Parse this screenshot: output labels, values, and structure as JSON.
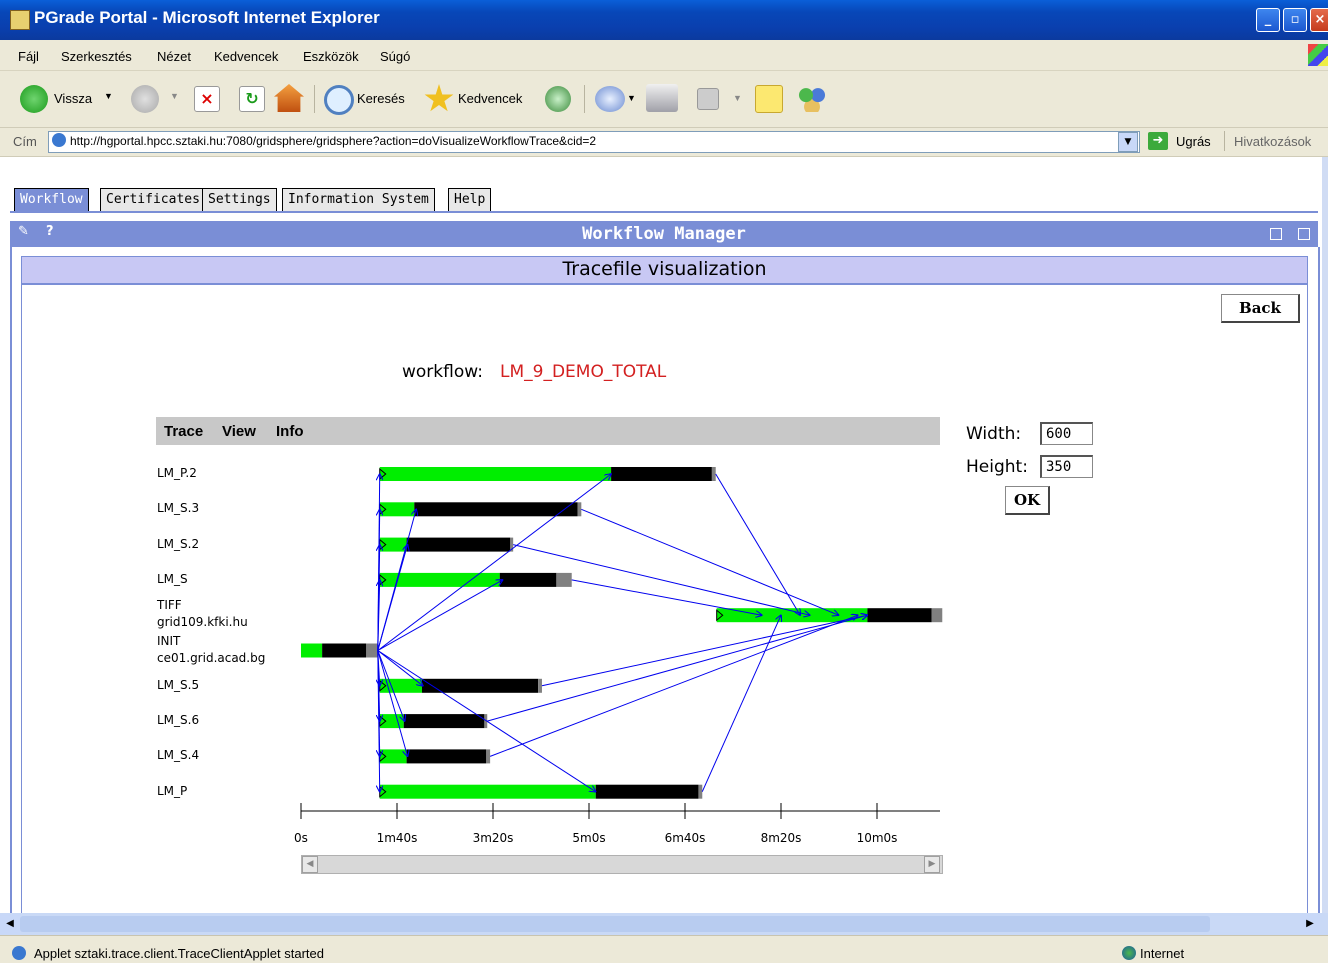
{
  "window": {
    "title": "PGrade Portal - Microsoft Internet Explorer"
  },
  "menu": [
    "Fájl",
    "Szerkesztés",
    "Nézet",
    "Kedvencek",
    "Eszközök",
    "Súgó"
  ],
  "toolbar": {
    "back_label": "Vissza",
    "search_label": "Keresés",
    "favorites_label": "Kedvencek"
  },
  "address": {
    "label": "Cím",
    "url": "http://hgportal.hpcc.sztaki.hu:7080/gridsphere/gridsphere?action=doVisualizeWorkflowTrace&cid=2",
    "go_label": "Ugrás",
    "links_label": "Hivatkozások"
  },
  "tabs": [
    "Workflow",
    "Certificates",
    "Settings",
    "Information System",
    "Help"
  ],
  "portlet": {
    "title": "Workflow Manager",
    "edit_icon": "pencil-icon",
    "help_label": "?"
  },
  "page": {
    "subheader": "Tracefile visualization",
    "back_label": "Back",
    "workflow_label": "workflow:",
    "workflow_name": "LM_9_DEMO_TOTAL"
  },
  "applet": {
    "menu": [
      "Trace",
      "View",
      "Info"
    ],
    "width_label": "Width:",
    "width_value": "600",
    "height_label": "Height:",
    "height_value": "350",
    "ok_label": "OK"
  },
  "status": {
    "text": "Applet sztaki.trace.client.TraceClientApplet started",
    "zone": "Internet"
  },
  "chart_data": {
    "type": "gantt",
    "x_unit": "seconds",
    "xlim": [
      0,
      660
    ],
    "x_ticks": [
      0,
      100,
      200,
      300,
      400,
      500,
      600
    ],
    "x_tick_labels": [
      "0s",
      "1m40s",
      "3m20s",
      "5m0s",
      "6m40s",
      "8m20s",
      "10m0s"
    ],
    "colors": {
      "running": "#00ee00",
      "waiting": "#000000",
      "end": "#808080",
      "arrow": "#0000ee"
    },
    "rows": [
      {
        "label": [
          "LM_P.2"
        ],
        "start": 82,
        "green_end": 323,
        "black_end": 428,
        "gray_end": 432
      },
      {
        "label": [
          "LM_S.3"
        ],
        "start": 82,
        "green_end": 118,
        "black_end": 288,
        "gray_end": 292
      },
      {
        "label": [
          "LM_S.2"
        ],
        "start": 82,
        "green_end": 110,
        "black_end": 218,
        "gray_end": 221
      },
      {
        "label": [
          "LM_S"
        ],
        "start": 82,
        "green_end": 207,
        "black_end": 266,
        "gray_end": 282
      },
      {
        "label": [
          "TIFF",
          "grid109.kfki.hu"
        ],
        "start": 433,
        "green_end": 590,
        "black_end": 657,
        "gray_end": 668
      },
      {
        "label": [
          "INIT",
          "ce01.grid.acad.bg"
        ],
        "start": 0,
        "green_end": 22,
        "black_end": 68,
        "gray_end": 80,
        "no_marker": true
      },
      {
        "label": [
          "LM_S.5"
        ],
        "start": 82,
        "green_end": 126,
        "black_end": 247,
        "gray_end": 251
      },
      {
        "label": [
          "LM_S.6"
        ],
        "start": 82,
        "green_end": 107,
        "black_end": 191,
        "gray_end": 194
      },
      {
        "label": [
          "LM_S.4"
        ],
        "start": 82,
        "green_end": 110,
        "black_end": 193,
        "gray_end": 197
      },
      {
        "label": [
          "LM_P"
        ],
        "start": 82,
        "green_end": 307,
        "black_end": 414,
        "gray_end": 418
      }
    ],
    "arrows": [
      [
        80,
        5,
        82,
        0
      ],
      [
        80,
        5,
        82,
        1
      ],
      [
        80,
        5,
        82,
        2
      ],
      [
        80,
        5,
        82,
        3
      ],
      [
        80,
        5,
        82,
        6
      ],
      [
        80,
        5,
        82,
        7
      ],
      [
        80,
        5,
        82,
        8
      ],
      [
        80,
        5,
        82,
        9
      ],
      [
        80,
        5,
        120,
        1
      ],
      [
        80,
        5,
        111,
        2
      ],
      [
        80,
        5,
        210,
        3
      ],
      [
        80,
        5,
        323,
        0
      ],
      [
        80,
        5,
        127,
        6
      ],
      [
        80,
        5,
        108,
        7
      ],
      [
        80,
        5,
        111,
        8
      ],
      [
        80,
        5,
        307,
        9
      ],
      [
        432,
        0,
        520,
        4
      ],
      [
        292,
        1,
        560,
        4
      ],
      [
        221,
        2,
        530,
        4
      ],
      [
        282,
        3,
        480,
        4
      ],
      [
        251,
        6,
        590,
        4
      ],
      [
        194,
        7,
        590,
        4
      ],
      [
        197,
        8,
        580,
        4
      ],
      [
        418,
        9,
        500,
        4
      ]
    ]
  }
}
